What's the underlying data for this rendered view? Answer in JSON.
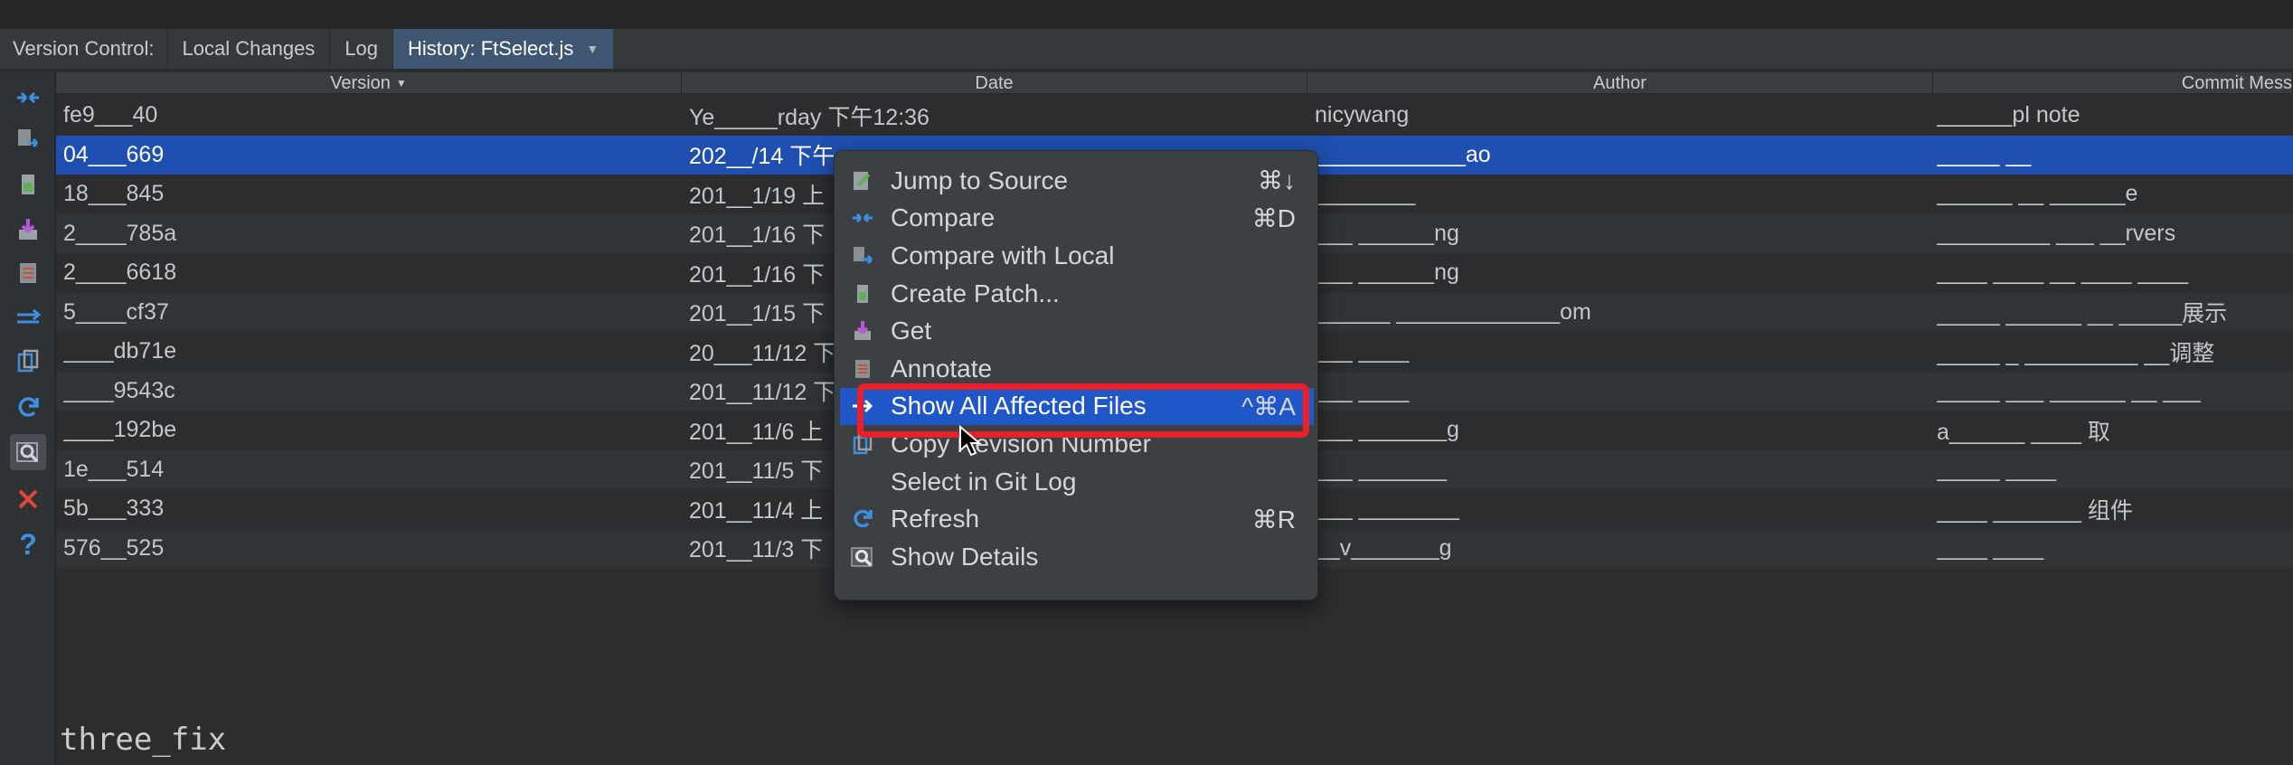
{
  "tabs": {
    "version_control": "Version Control:",
    "local_changes": "Local Changes",
    "log": "Log",
    "history": "History: FtSelect.js"
  },
  "columns": {
    "version": "Version",
    "date": "Date",
    "author": "Author",
    "commit_message": "Commit Mess"
  },
  "rows": [
    {
      "version": "fe9___40",
      "date": "Ye_____rday 下午12:36",
      "author": "nicywang",
      "message": "______pl note"
    },
    {
      "version": "04___669",
      "date": "202__/14 下午",
      "author": "____________ao",
      "message": "_____ __"
    },
    {
      "version": "18___845",
      "date": "201__1/19 上",
      "author": "________",
      "message": "______ __ ______e"
    },
    {
      "version": "2____785a",
      "date": "201__1/16 下",
      "author": "___ ______ng",
      "message": "_________ ___ __rvers"
    },
    {
      "version": "2____6618",
      "date": "201__1/16 下",
      "author": "___ ______ng",
      "message": "____ ____ __ ____ ____"
    },
    {
      "version": "5____cf37",
      "date": "201__1/15 下",
      "author": "______ _____________om",
      "message": "_____ ______ __ _____展示"
    },
    {
      "version": "____db71e",
      "date": "20___11/12 下",
      "author": "___ ____",
      "message": "_____ _ _________ __调整"
    },
    {
      "version": "____9543c",
      "date": "201__11/12 下",
      "author": "___ ____",
      "message": "_____ ___ ______ __ ___"
    },
    {
      "version": "____192be",
      "date": "201__11/6 上",
      "author": "___ _______g",
      "message": "a______ ____ 取"
    },
    {
      "version": "1e___514",
      "date": "201__11/5 下",
      "author": "___ _______",
      "message": "_____ ____"
    },
    {
      "version": "5b___333",
      "date": "201__11/4 上",
      "author": "___ ________",
      "message": "____ _______ 组件"
    },
    {
      "version": "576__525",
      "date": "201__11/3 下",
      "author": "__v_______g",
      "message": "____ ____"
    }
  ],
  "context_menu": {
    "items": [
      {
        "label": "Jump to Source",
        "shortcut": "⌘↓",
        "icon": "jump-to-source-icon"
      },
      {
        "label": "Compare",
        "shortcut": "⌘D",
        "icon": "compare-icon"
      },
      {
        "label": "Compare with Local",
        "shortcut": "",
        "icon": "compare-with-local-icon"
      },
      {
        "label": "Create Patch...",
        "shortcut": "",
        "icon": "create-patch-icon"
      },
      {
        "label": "Get",
        "shortcut": "",
        "icon": "get-icon"
      },
      {
        "label": "Annotate",
        "shortcut": "",
        "icon": "annotate-icon"
      },
      {
        "label": "Show All Affected Files",
        "shortcut": "^⌘A",
        "icon": "affected-files-icon"
      },
      {
        "label": "Copy Revision Number",
        "shortcut": "",
        "icon": "copy-icon"
      },
      {
        "label": "Select in Git Log",
        "shortcut": "",
        "icon": ""
      },
      {
        "label": "Refresh",
        "shortcut": "⌘R",
        "icon": "refresh-icon"
      },
      {
        "label": "Show Details",
        "shortcut": "",
        "icon": "show-details-icon"
      }
    ]
  },
  "commit_message": "three_fix",
  "colors": {
    "selection": "#1f4fb0",
    "highlight_border": "#e8202a",
    "accent_blue": "#3d8fe0"
  }
}
